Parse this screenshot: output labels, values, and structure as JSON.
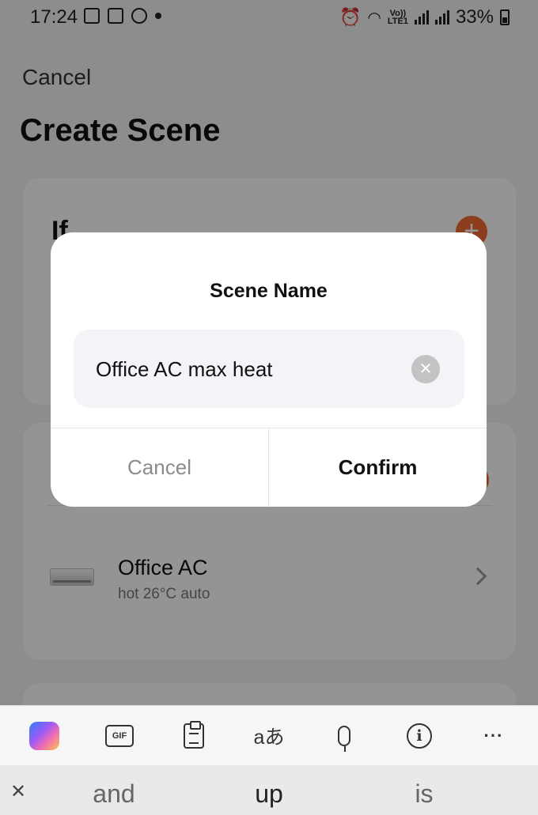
{
  "status_bar": {
    "time": "17:24",
    "battery": "33%",
    "network_tag_top": "Vo))",
    "network_tag_bottom": "LTE1"
  },
  "header": {
    "cancel_label": "Cancel",
    "title": "Create Scene"
  },
  "if_card": {
    "label": "If"
  },
  "then_card": {
    "device_name": "Office AC",
    "device_state": "hot 26°C auto"
  },
  "dialog": {
    "title": "Scene Name",
    "input_value": "Office AC max heat",
    "cancel_label": "Cancel",
    "confirm_label": "Confirm"
  },
  "keyboard": {
    "toolbar": [
      "copilot-icon",
      "gif-icon",
      "clipboard-icon",
      "translate-icon",
      "microphone-icon",
      "info-icon",
      "more-icon"
    ],
    "gif_label": "GIF",
    "translate_label": "aあ",
    "suggestions": [
      "and",
      "up",
      "is"
    ]
  },
  "colors": {
    "accent": "#f06a35",
    "overlay": "rgba(0,0,0,0.42)"
  }
}
